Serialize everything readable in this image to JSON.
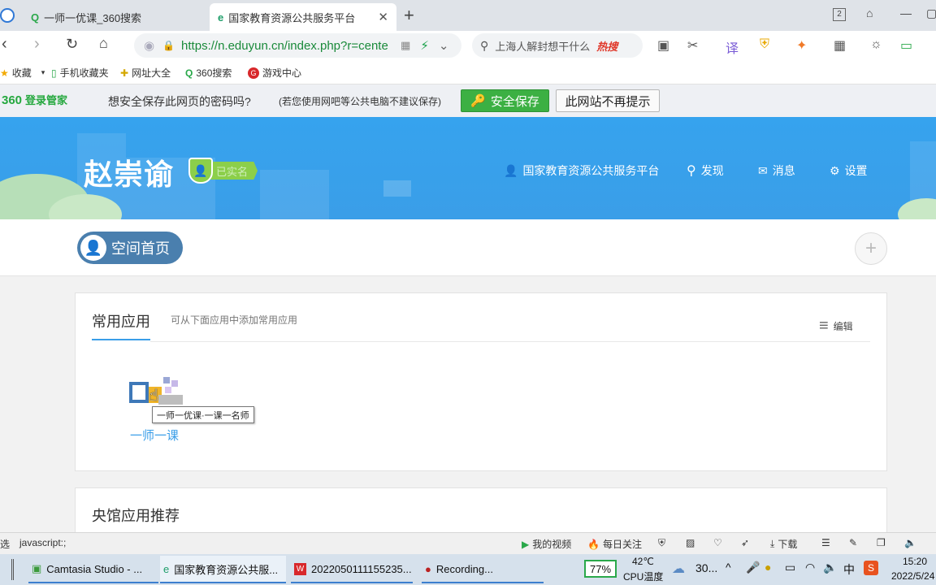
{
  "browser": {
    "tabs": [
      {
        "title": "一师一优课_360搜索",
        "active": false
      },
      {
        "title": "国家教育资源公共服务平台",
        "active": true
      }
    ],
    "tab_count": "2",
    "url": "https://n.eduyun.cn/index.php?r=cente",
    "search_text": "上海人解封想干什么",
    "search_hot": "热搜",
    "bookmarks": [
      "收藏",
      "手机收藏夹",
      "网址大全",
      "360搜索",
      "游戏中心"
    ]
  },
  "password_bar": {
    "logo": "360",
    "logo_sub": "登录管家",
    "question": "想安全保存此网页的密码吗?",
    "note": "(若您使用网吧等公共电脑不建议保存)",
    "save_label": "安全保存",
    "dismiss_label": "此网站不再提示"
  },
  "banner": {
    "user_name": "赵崇谕",
    "verified_label": "已实名",
    "nav": {
      "platform": "国家教育资源公共服务平台",
      "discover": "发现",
      "messages": "消息",
      "settings": "设置"
    }
  },
  "space": {
    "home_label": "空间首页",
    "add_symbol": "+"
  },
  "common_apps": {
    "title": "常用应用",
    "hint": "可从下面应用中添加常用应用",
    "edit_label": "编辑",
    "app_label": "一师一课",
    "tooltip": "一师一优课·一课一名师"
  },
  "recommend": {
    "title": "央馆应用推荐"
  },
  "status_bar": {
    "left_text": "选",
    "link_text": "javascript:;",
    "my_video": "我的视频",
    "daily_focus": "每日关注",
    "download": "下载"
  },
  "taskbar": {
    "tasks": [
      "Camtasia Studio - ...",
      "国家教育资源公共服...",
      "2022050111155235...",
      "Recording..."
    ],
    "cpu_percent": "77%",
    "temp": "42℃",
    "temp_label": "CPU温度",
    "weather": "30...",
    "ime": "中",
    "time": "15:20",
    "date": "2022/5/24"
  },
  "colors": {
    "banner": "#3aa0ea",
    "accent": "#3a9ee8",
    "save_green": "#3cb043",
    "space_btn": "#4a7fae"
  }
}
